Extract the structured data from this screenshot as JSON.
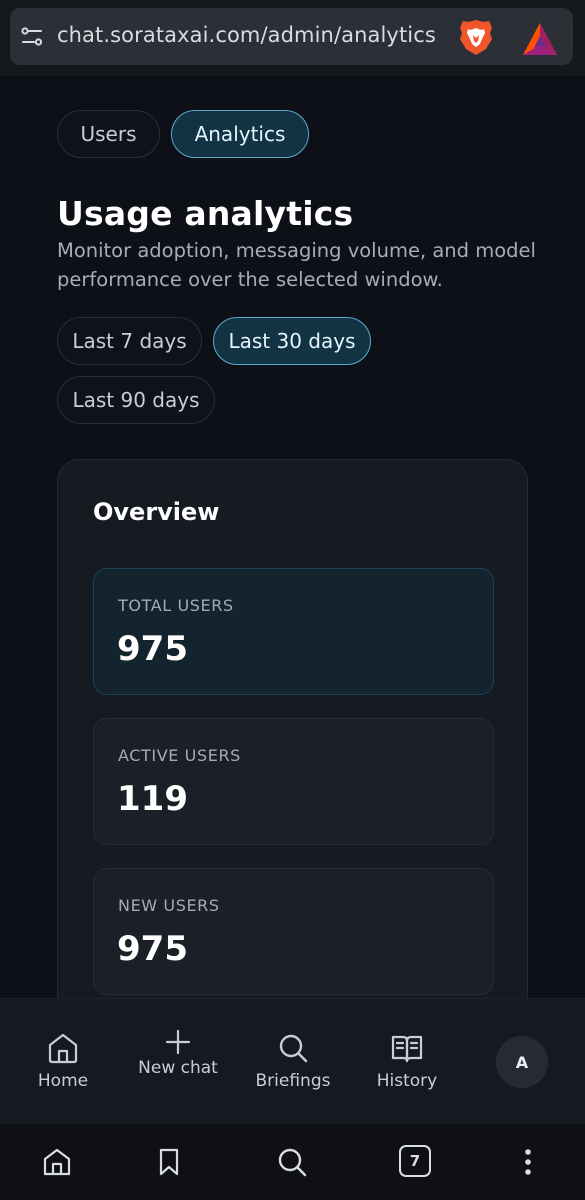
{
  "browser": {
    "url": "chat.sorataxai.com/admin/analytics",
    "tab_count": "7"
  },
  "top_tabs": [
    {
      "label": "Users",
      "active": false
    },
    {
      "label": "Analytics",
      "active": true
    }
  ],
  "header": {
    "title": "Usage analytics",
    "subtitle": "Monitor adoption, messaging volume, and model performance over the selected window."
  },
  "range_filters": [
    {
      "label": "Last 7 days",
      "active": false
    },
    {
      "label": "Last 30 days",
      "active": true
    },
    {
      "label": "Last 90 days",
      "active": false
    }
  ],
  "overview": {
    "title": "Overview",
    "stats": [
      {
        "label": "TOTAL USERS",
        "value": "975"
      },
      {
        "label": "ACTIVE USERS",
        "value": "119"
      },
      {
        "label": "NEW USERS",
        "value": "975"
      }
    ]
  },
  "app_nav": {
    "items": [
      {
        "label": "Home",
        "icon": "home-icon"
      },
      {
        "label": "New chat",
        "icon": "plus-icon"
      },
      {
        "label": "Briefings",
        "icon": "search-icon"
      },
      {
        "label": "History",
        "icon": "book-icon"
      }
    ],
    "avatar_initial": "A"
  },
  "colors": {
    "accent": "#5fa9c9",
    "page_bg": "#0d1117",
    "card_bg": "#161b22"
  }
}
